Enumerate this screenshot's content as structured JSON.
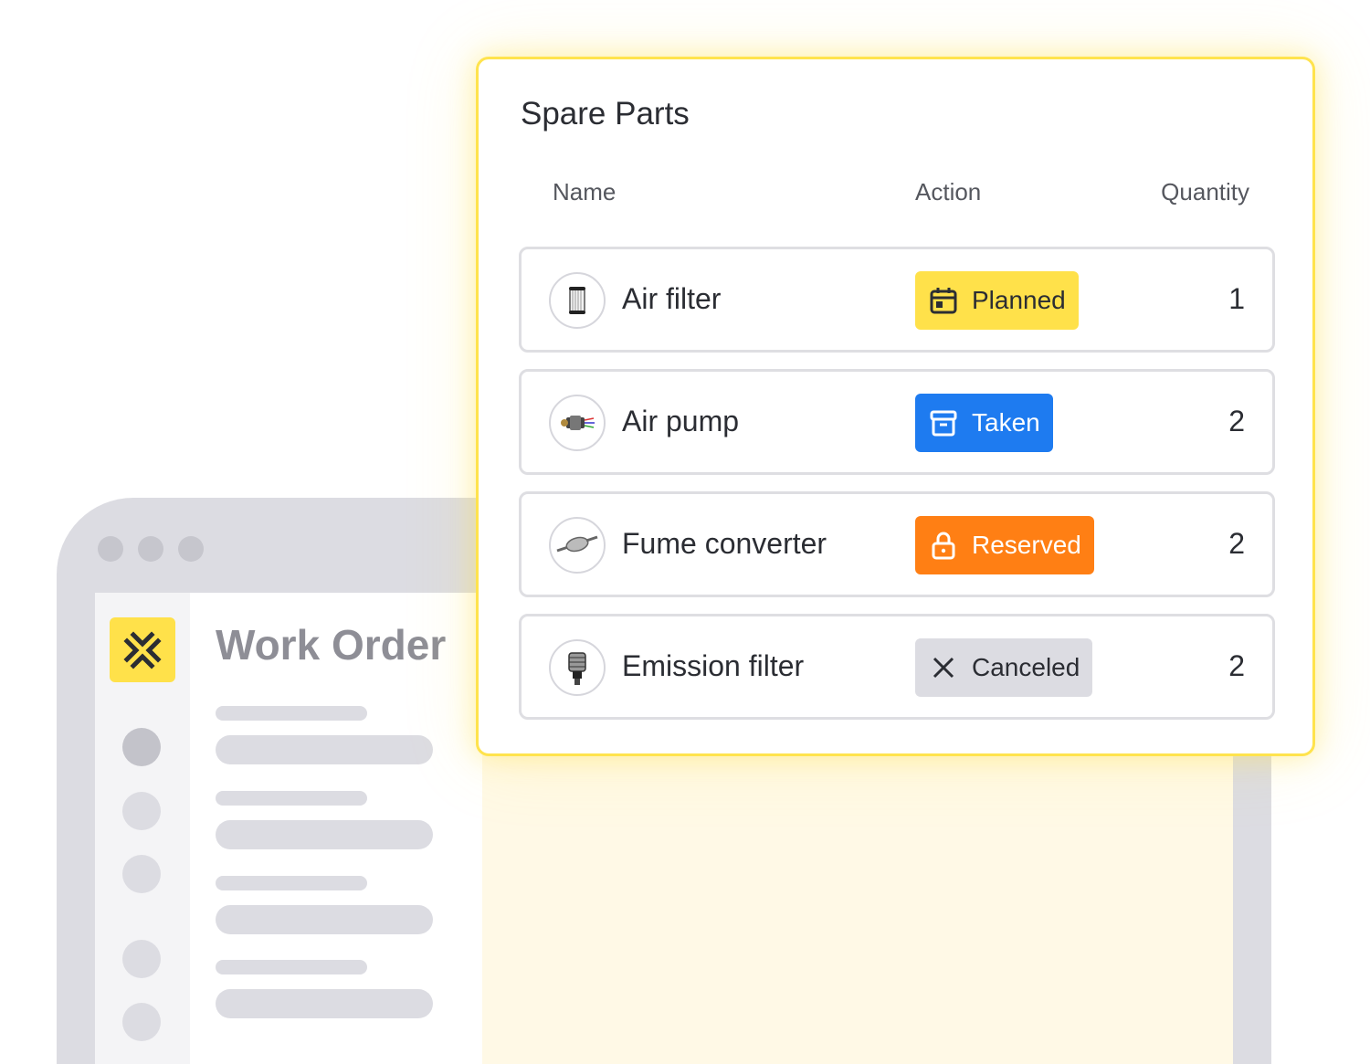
{
  "app": {
    "logo_icon": "collapse-arrows-icon",
    "brand_color": "#ffe14a"
  },
  "work_order": {
    "title": "Work Order"
  },
  "spare_parts": {
    "title": "Spare Parts",
    "columns": {
      "name": "Name",
      "action": "Action",
      "quantity": "Quantity"
    },
    "rows": [
      {
        "name": "Air filter",
        "thumb": "air-filter-image",
        "action": "Planned",
        "action_icon": "calendar-icon",
        "action_bg": "#ffe14a",
        "action_fg": "#2b2d33",
        "quantity": "1"
      },
      {
        "name": "Air pump",
        "thumb": "air-pump-image",
        "action": "Taken",
        "action_icon": "archive-box-icon",
        "action_bg": "#1e7bf0",
        "action_fg": "#ffffff",
        "quantity": "2"
      },
      {
        "name": "Fume converter",
        "thumb": "fume-converter-image",
        "action": "Reserved",
        "action_icon": "lock-icon",
        "action_bg": "#ff7f14",
        "action_fg": "#ffffff",
        "quantity": "2"
      },
      {
        "name": "Emission filter",
        "thumb": "emission-filter-image",
        "action": "Canceled",
        "action_icon": "close-icon",
        "action_bg": "#dcdce2",
        "action_fg": "#2b2d33",
        "quantity": "2"
      }
    ]
  }
}
